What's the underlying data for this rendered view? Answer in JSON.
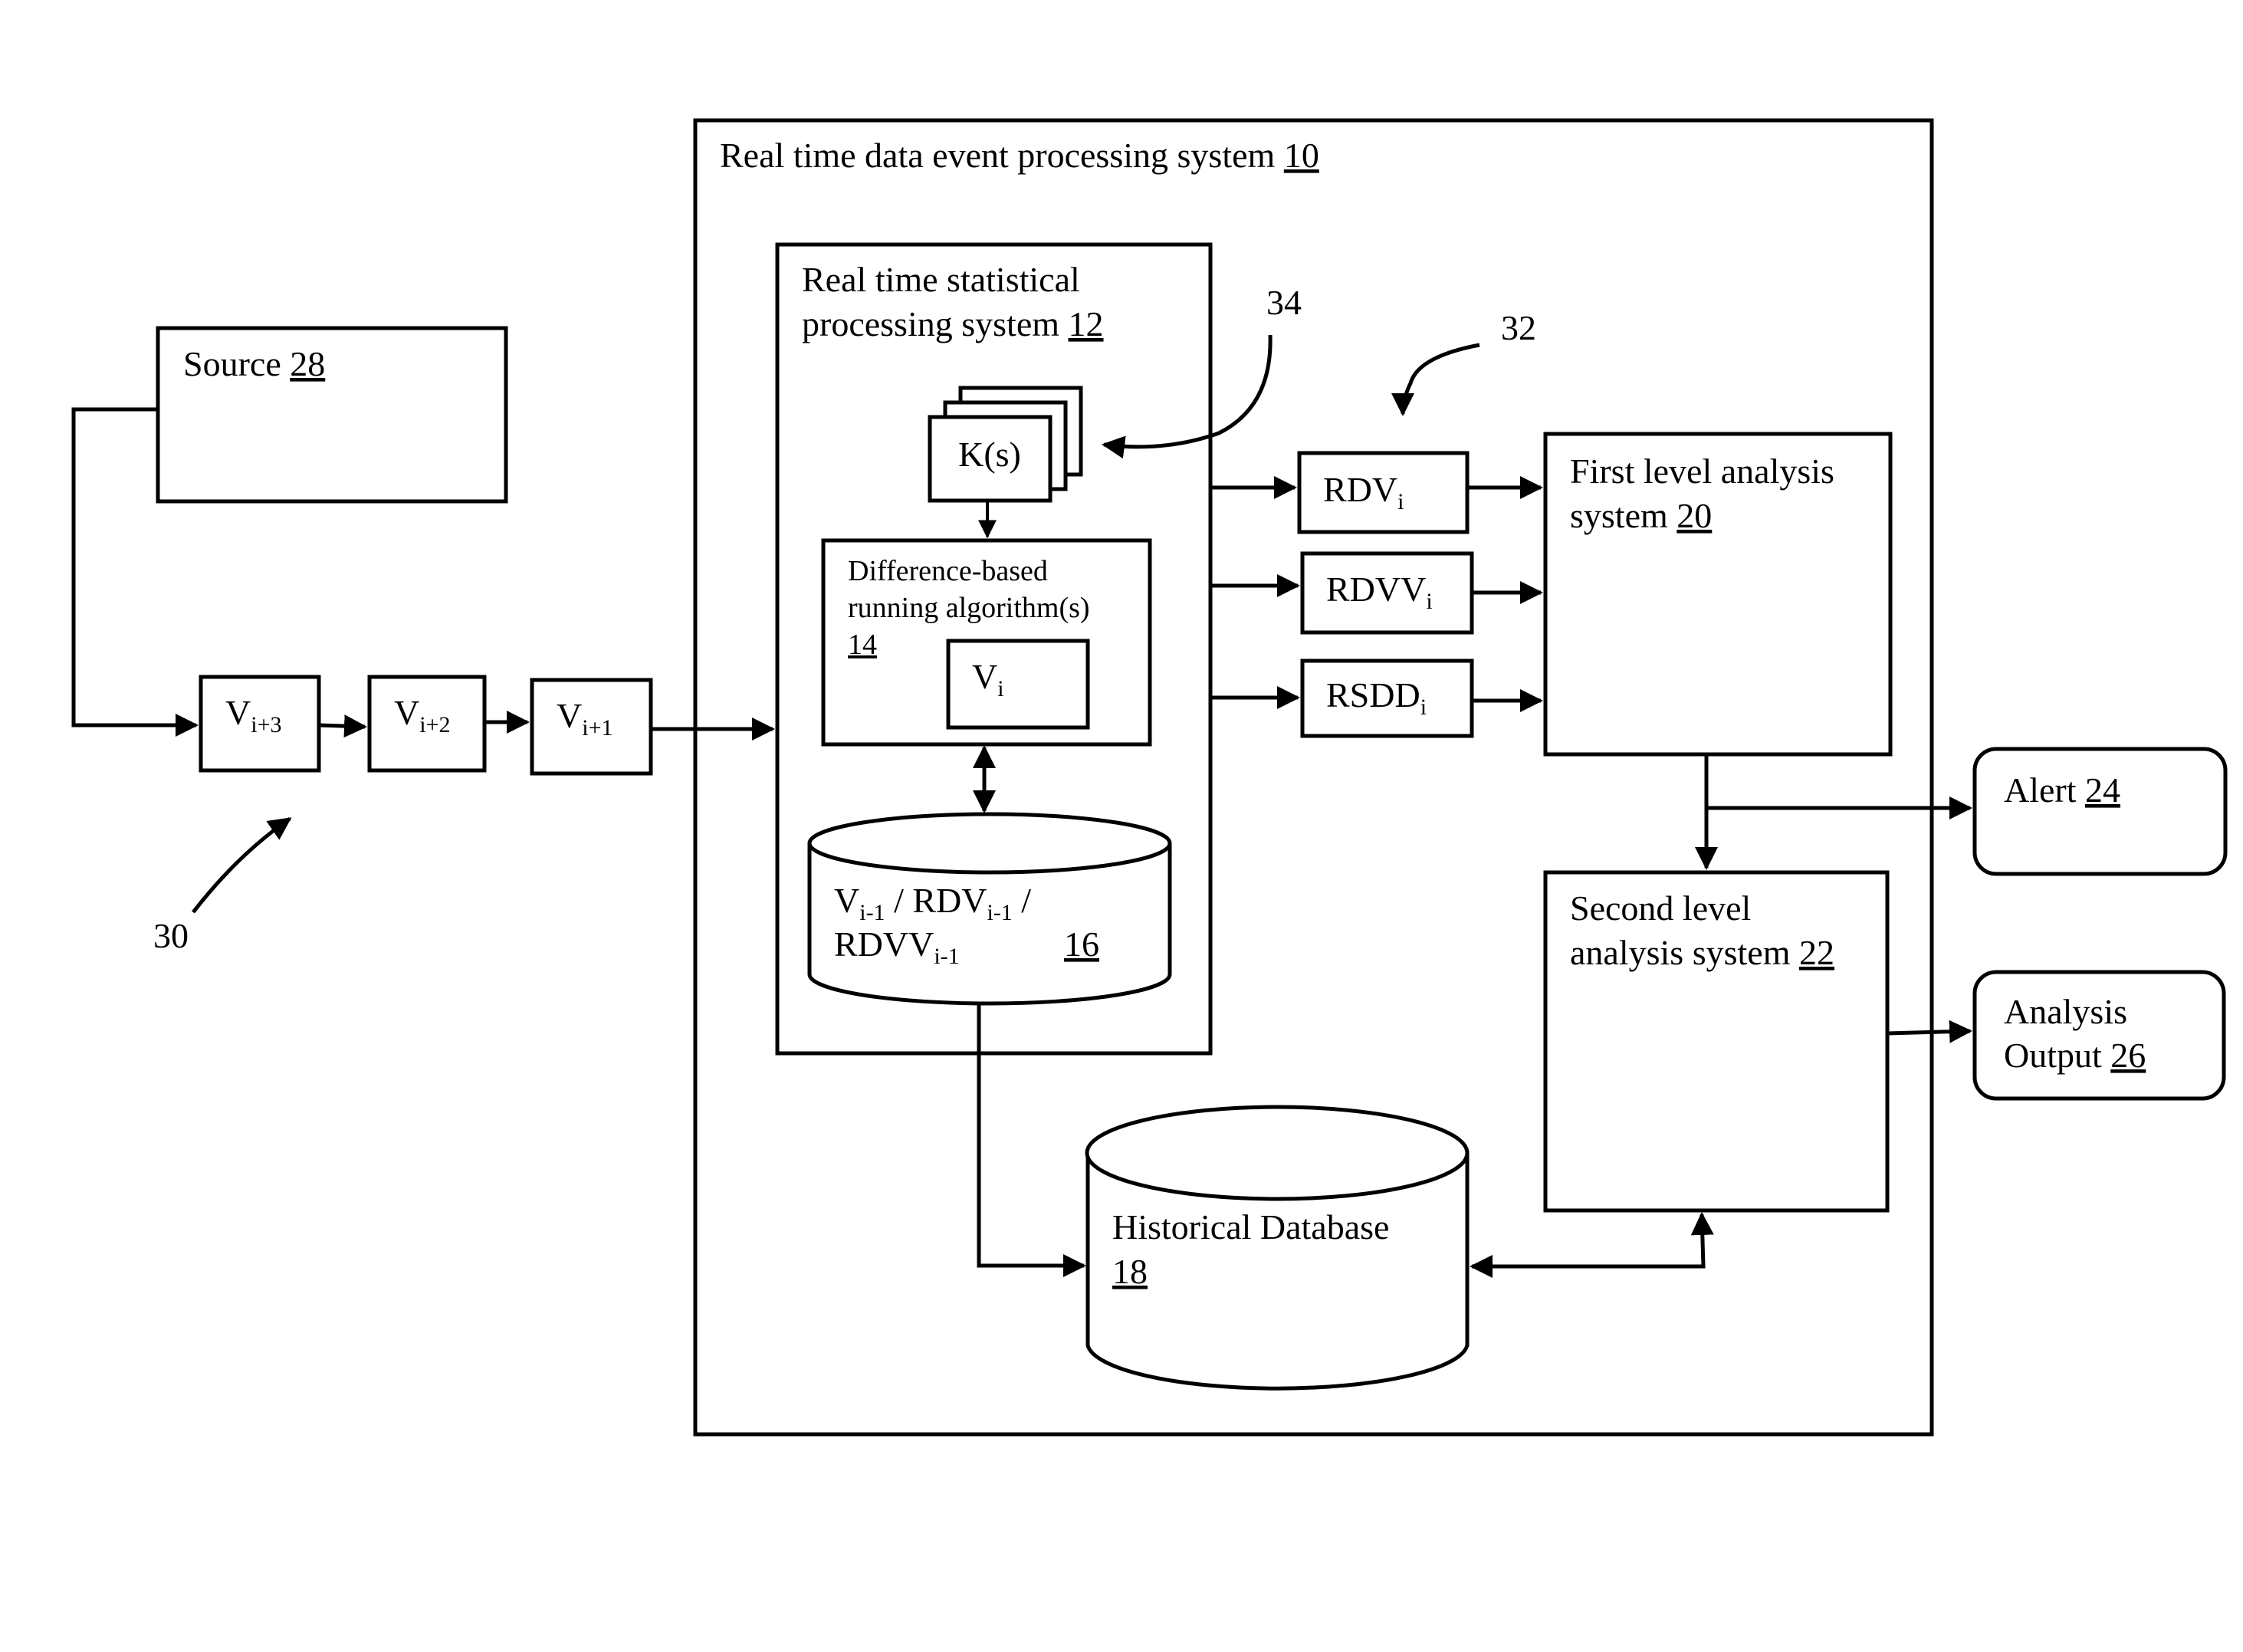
{
  "outer_system": {
    "label": "Real time data event processing system ",
    "ref": "10"
  },
  "stat_system": {
    "line1": "Real time statistical",
    "line2": "processing system ",
    "ref": "12"
  },
  "constants": {
    "label": "K(s)"
  },
  "algorithm": {
    "line1": "Difference-based",
    "line2": "running algorithm(s)",
    "ref": "14"
  },
  "current_value": {
    "base": "V",
    "sub": "i"
  },
  "state_store": {
    "line1_parts": [
      {
        "base": "V",
        "sub": "i-1"
      },
      {
        "text": " / "
      },
      {
        "base": "RDV",
        "sub": "i-1"
      },
      {
        "text": "  /"
      }
    ],
    "line2_parts": [
      {
        "base": "RDVV",
        "sub": "i-1"
      }
    ],
    "ref": "16"
  },
  "historical_db": {
    "line1": "Historical Database",
    "ref": "18"
  },
  "source": {
    "label": "Source ",
    "ref": "28"
  },
  "stream": [
    {
      "base": "V",
      "sub": "i+3"
    },
    {
      "base": "V",
      "sub": "i+2"
    },
    {
      "base": "V",
      "sub": "i+1"
    }
  ],
  "outputs": [
    {
      "base": "RDV",
      "sub": "i"
    },
    {
      "base": "RDVV",
      "sub": "i"
    },
    {
      "base": "RSDD",
      "sub": "i"
    }
  ],
  "first_level": {
    "line1": "First level analysis",
    "line2": "system ",
    "ref": "20"
  },
  "second_level": {
    "line1": "Second level",
    "line2": "analysis system ",
    "ref": "22"
  },
  "alert": {
    "label": "Alert ",
    "ref": "24"
  },
  "analysis_output": {
    "line1": "Analysis",
    "line2": "Output ",
    "ref": "26"
  },
  "callouts": {
    "stream_ref": "30",
    "outputs_ref": "32",
    "constants_ref": "34"
  }
}
